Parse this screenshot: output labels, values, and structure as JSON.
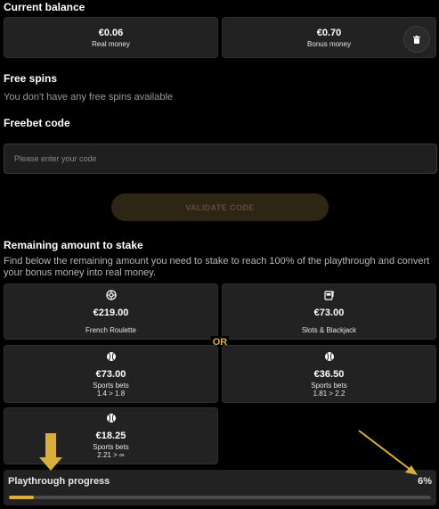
{
  "balance": {
    "title": "Current balance",
    "real": {
      "amount": "€0.06",
      "label": "Real money"
    },
    "bonus": {
      "amount": "€0.70",
      "label": "Bonus money"
    },
    "delete_icon": "trash-icon"
  },
  "free_spins": {
    "title": "Free spins",
    "message": "You don't have any free spins available"
  },
  "freebet": {
    "title": "Freebet code",
    "placeholder": "Please enter your code",
    "button": "VALIDATE CODE"
  },
  "stake": {
    "title": "Remaining amount to stake",
    "description": "Find below the remaining amount you need to stake to reach 100% of the playthrough and convert your bonus money into real money.",
    "or_label": "OR",
    "items": [
      {
        "icon": "roulette-icon",
        "amount": "€219.00",
        "label": "French Roulette",
        "odds": ""
      },
      {
        "icon": "slot-machine-icon",
        "amount": "€73.00",
        "label": "Slots & Blackjack",
        "odds": ""
      },
      {
        "icon": "tennis-ball-icon",
        "amount": "€73.00",
        "label": "Sports bets",
        "odds": "1.4 > 1.8"
      },
      {
        "icon": "tennis-ball-icon",
        "amount": "€36.50",
        "label": "Sports bets",
        "odds": "1.81 > 2.2"
      },
      {
        "icon": "tennis-ball-icon",
        "amount": "€18.25",
        "label": "Sports bets",
        "odds": "2.21 > ∞"
      }
    ]
  },
  "playthrough": {
    "label": "Playthrough progress",
    "percent_text": "6%",
    "percent": 6
  },
  "colors": {
    "accent": "#d9ae3a",
    "card": "#222222",
    "background": "#000000"
  }
}
